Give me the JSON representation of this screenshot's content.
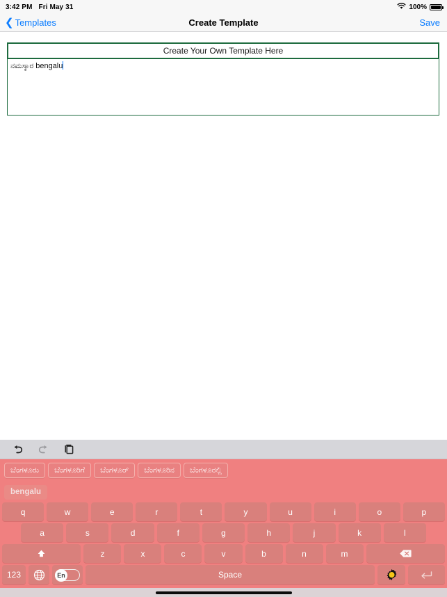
{
  "status_bar": {
    "time": "3:42 PM",
    "date": "Fri May 31",
    "wifi_icon": "wifi-icon",
    "battery_percent": "100%",
    "battery_icon": "battery-full-icon"
  },
  "nav_bar": {
    "back_chevron_icon": "chevron-left-icon",
    "back_label": "Templates",
    "title": "Create Template",
    "save_label": "Save",
    "accent_color": "#0a7cff"
  },
  "template_editor": {
    "header_label": "Create Your Own Template Here",
    "border_color": "#1d6b3e",
    "text_value": "ನಮಸ್ಕಾರ bengalu",
    "placeholder": "",
    "caret_color": "#0a7cff"
  },
  "keyboard": {
    "background_color": "#f08080",
    "key_color": "#d9807c",
    "toolbar": {
      "undo_icon": "undo-icon",
      "redo_icon": "redo-icon",
      "paste_icon": "paste-icon",
      "background_color": "#d6d6da"
    },
    "suggestions": [
      "ಬೆಂಗಳೂರು",
      "ಬೆಂಗಳೂರಿಗೆ",
      "ಬೆಂಗಳೂರ್",
      "ಬೆಂಗಳೂರಿನ",
      "ಬೆಂಗಳೂರಲ್ಲಿ"
    ],
    "composition": "bengalu",
    "rows": {
      "row1": [
        "q",
        "w",
        "e",
        "r",
        "t",
        "y",
        "u",
        "i",
        "o",
        "p"
      ],
      "row2": [
        "a",
        "s",
        "d",
        "f",
        "g",
        "h",
        "j",
        "k",
        "l"
      ],
      "row3_letters": [
        "z",
        "x",
        "c",
        "v",
        "b",
        "n",
        "m"
      ],
      "shift_icon": "shift-up-arrow-icon",
      "backspace_icon": "backspace-icon"
    },
    "bottom_row": {
      "numeric_label": "123",
      "globe_icon": "globe-icon",
      "language_label": "En",
      "space_label": "Space",
      "settings_icon": "gear-icon",
      "settings_icon_color": "#f5c518",
      "return_icon": "return-key-icon"
    }
  },
  "home_indicator": "home-indicator"
}
